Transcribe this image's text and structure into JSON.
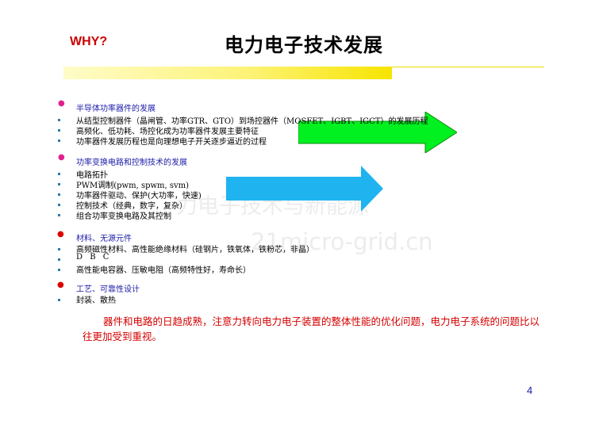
{
  "header": {
    "why_label": "WHY?",
    "title": "电力电子技术发展"
  },
  "watermark": {
    "line1": "力电子技术与新能源",
    "line2": "21micro-grid.cn"
  },
  "sections": [
    {
      "heading": "半导体功率器件的发展",
      "items": [
        "从结型控制器件（晶闸管、功率GTR、GTO）到场控器件（MOSFET、IGBT、IGCT）的发展历程",
        "高频化、低功耗、场控化成为功率器件发展主要特征",
        "功率器件发展历程也是向理想电子开关逐步逼近的过程"
      ]
    },
    {
      "heading": "功率变换电路和控制技术的发展",
      "items": [
        "电路拓扑",
        "PWM调制(pwm, spwm,  svm)",
        "功率器件驱动、保护(大功率，快速)",
        "控制技术（经典，数字，复杂）",
        "组合功率变换电路及其控制"
      ]
    },
    {
      "heading": "材料、无源元件",
      "items": [
        "高频磁性材料、高性能绝缘材料（硅钢片，铁氧体，铁粉芯，非晶）",
        "D B C",
        "高性能电容器、压敏电阻（高频特性好，寿命长）"
      ]
    },
    {
      "heading": "工艺、可靠性设计",
      "items": [
        "封装、散热"
      ]
    }
  ],
  "note": "器件和电路的日趋成熟，注意力转向电力电子装置的整体性能的优化问题，电力电子系统的问题比以往更加受到重视。",
  "page_number": "4",
  "colors": {
    "why": "#cc0000",
    "heading": "#1a1aa8",
    "section_bullet_1": "#e0208f",
    "section_bullet_red": "#dd0000",
    "item_bullet": "#2e79a8",
    "arrow_green": "#00f020",
    "arrow_blue": "#1fb4f0",
    "note": "#d40000"
  }
}
